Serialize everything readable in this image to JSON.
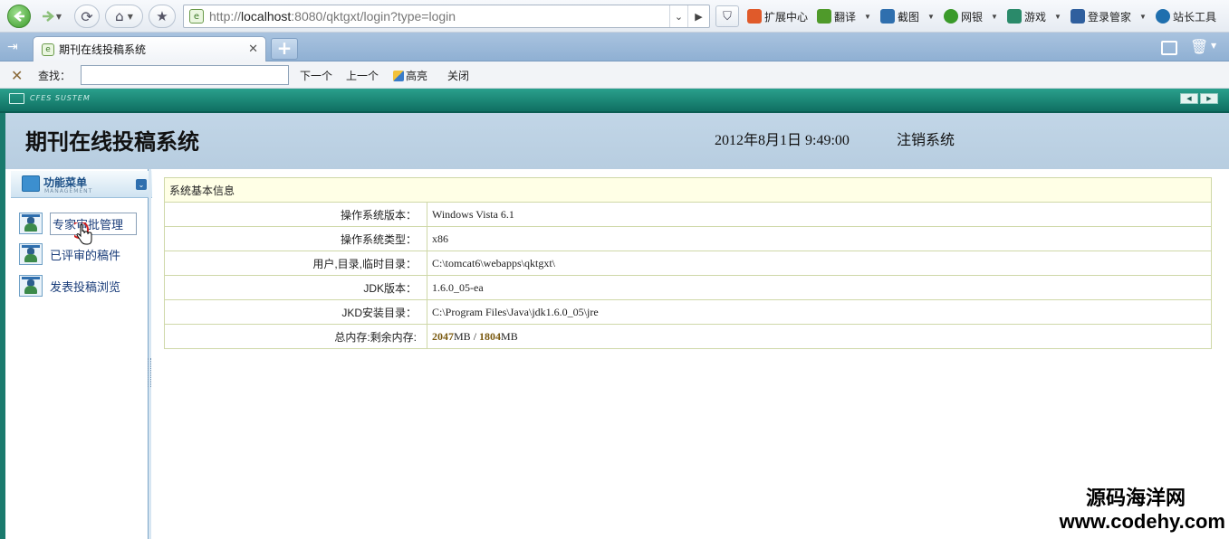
{
  "browser": {
    "url_prefix": "http://",
    "url_host": "localhost",
    "url_rest": ":8080/qktgxt/login?type=login",
    "extensions": [
      {
        "label": "扩展中心",
        "color": "#e05a2a"
      },
      {
        "label": "翻译",
        "color": "#4f9a2a"
      },
      {
        "label": "截图",
        "color": "#2f6fae"
      },
      {
        "label": "网银",
        "color": "#3a9a2a"
      },
      {
        "label": "游戏",
        "color": "#2a8a6a"
      },
      {
        "label": "登录管家",
        "color": "#2f5f9e"
      },
      {
        "label": "站长工具",
        "color": "#1f6fae"
      }
    ]
  },
  "tab": {
    "title": "期刊在线投稿系统"
  },
  "find_bar": {
    "label": "查找：",
    "next": "下一个",
    "prev": "上一个",
    "highlight": "高亮",
    "close": "关闭"
  },
  "app": {
    "strip_text": "CFES SUSTEM",
    "title": "期刊在线投稿系统",
    "datetime": "2012年8月1日  9:49:00",
    "logout": "注销系统"
  },
  "menu": {
    "title": "功能菜单",
    "subtitle": "MANAGEMENT",
    "items": [
      {
        "label": "专家审批管理"
      },
      {
        "label": "已评审的稿件"
      },
      {
        "label": "发表投稿浏览"
      }
    ]
  },
  "info": {
    "header": "系统基本信息",
    "rows": [
      {
        "label": "操作系统版本：",
        "value": "Windows Vista  6.1"
      },
      {
        "label": "操作系统类型：",
        "value": "x86"
      },
      {
        "label": "用户,目录,临时目录：",
        "value": "C:\\tomcat6\\webapps\\qktgxt\\"
      },
      {
        "label": "JDK版本：",
        "value": "1.6.0_05-ea"
      },
      {
        "label": "JKD安装目录：",
        "value": "C:\\Program Files\\Java\\jdk1.6.0_05\\jre"
      }
    ],
    "memory": {
      "label": "总内存:剩余内存:",
      "total": "2047",
      "free": "1804",
      "unit": "MB",
      "sep": " / "
    }
  },
  "watermark": {
    "cn": "源码海洋网",
    "en": "www.codehy.com"
  }
}
